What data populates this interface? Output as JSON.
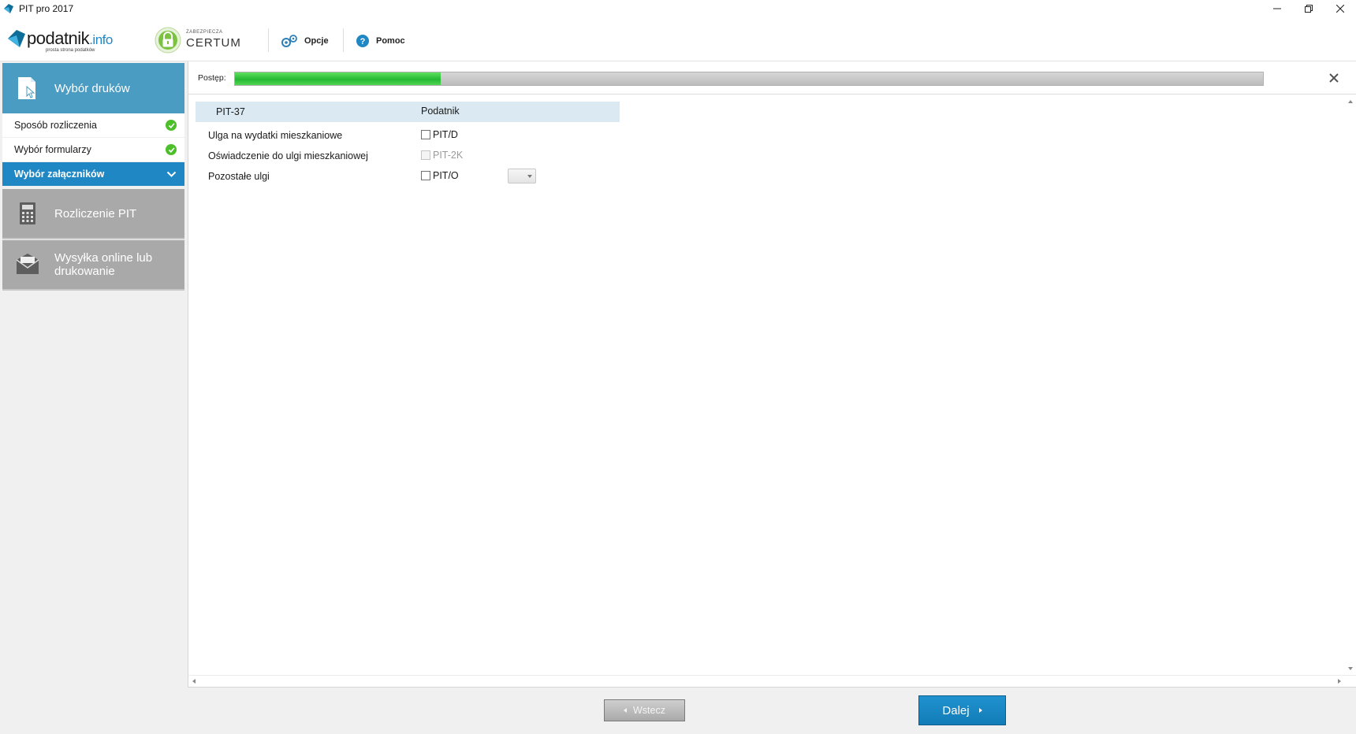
{
  "window": {
    "title": "PIT pro 2017",
    "controls": [
      "minimize-icon",
      "restore-icon",
      "close-icon"
    ]
  },
  "toolbar": {
    "logo_main": "podatnik",
    "logo_accent": ".info",
    "logo_sub": "prosta strona podatków",
    "certum_small": "ZABEZPIECZA",
    "certum_big": "CERTUM",
    "options_label": "Opcje",
    "help_label": "Pomoc"
  },
  "sidebar": {
    "sections": [
      {
        "label": "Wybór druków",
        "state": "active",
        "icon": "document-cursor-icon"
      },
      {
        "label": "Rozliczenie PIT",
        "state": "disabled",
        "icon": "calculator-icon"
      },
      {
        "label": "Wysyłka online lub drukowanie",
        "state": "disabled",
        "icon": "envelope-icon"
      }
    ],
    "steps": [
      {
        "label": "Sposób rozliczenia",
        "status": "done"
      },
      {
        "label": "Wybór formularzy",
        "status": "done"
      },
      {
        "label": "Wybór załączników",
        "status": "current"
      }
    ]
  },
  "progress": {
    "label": "Postęp:",
    "value": 0.2
  },
  "form": {
    "header_col1": "PIT-37",
    "header_col2": "Podatnik",
    "rows": [
      {
        "label": "Ulga na wydatki mieszkaniowe",
        "option": "PIT/D",
        "checked": false,
        "enabled": true
      },
      {
        "label": "Oświadczenie do ulgi mieszkaniowej",
        "option": "PIT-2K",
        "checked": false,
        "enabled": false
      },
      {
        "label": "Pozostałe ulgi",
        "option": "PIT/O",
        "checked": false,
        "enabled": true
      }
    ],
    "count_combo_value": ""
  },
  "footer": {
    "back_label": "Wstecz",
    "next_label": "Dalej"
  },
  "colors": {
    "accent": "#1e87c4",
    "sidebar_active": "#4a9cc2",
    "sidebar_disabled": "#a9a9a9",
    "row_highlight": "#dbeaf2",
    "progress_green": "#25b834",
    "check_green": "#4cbf2a"
  }
}
